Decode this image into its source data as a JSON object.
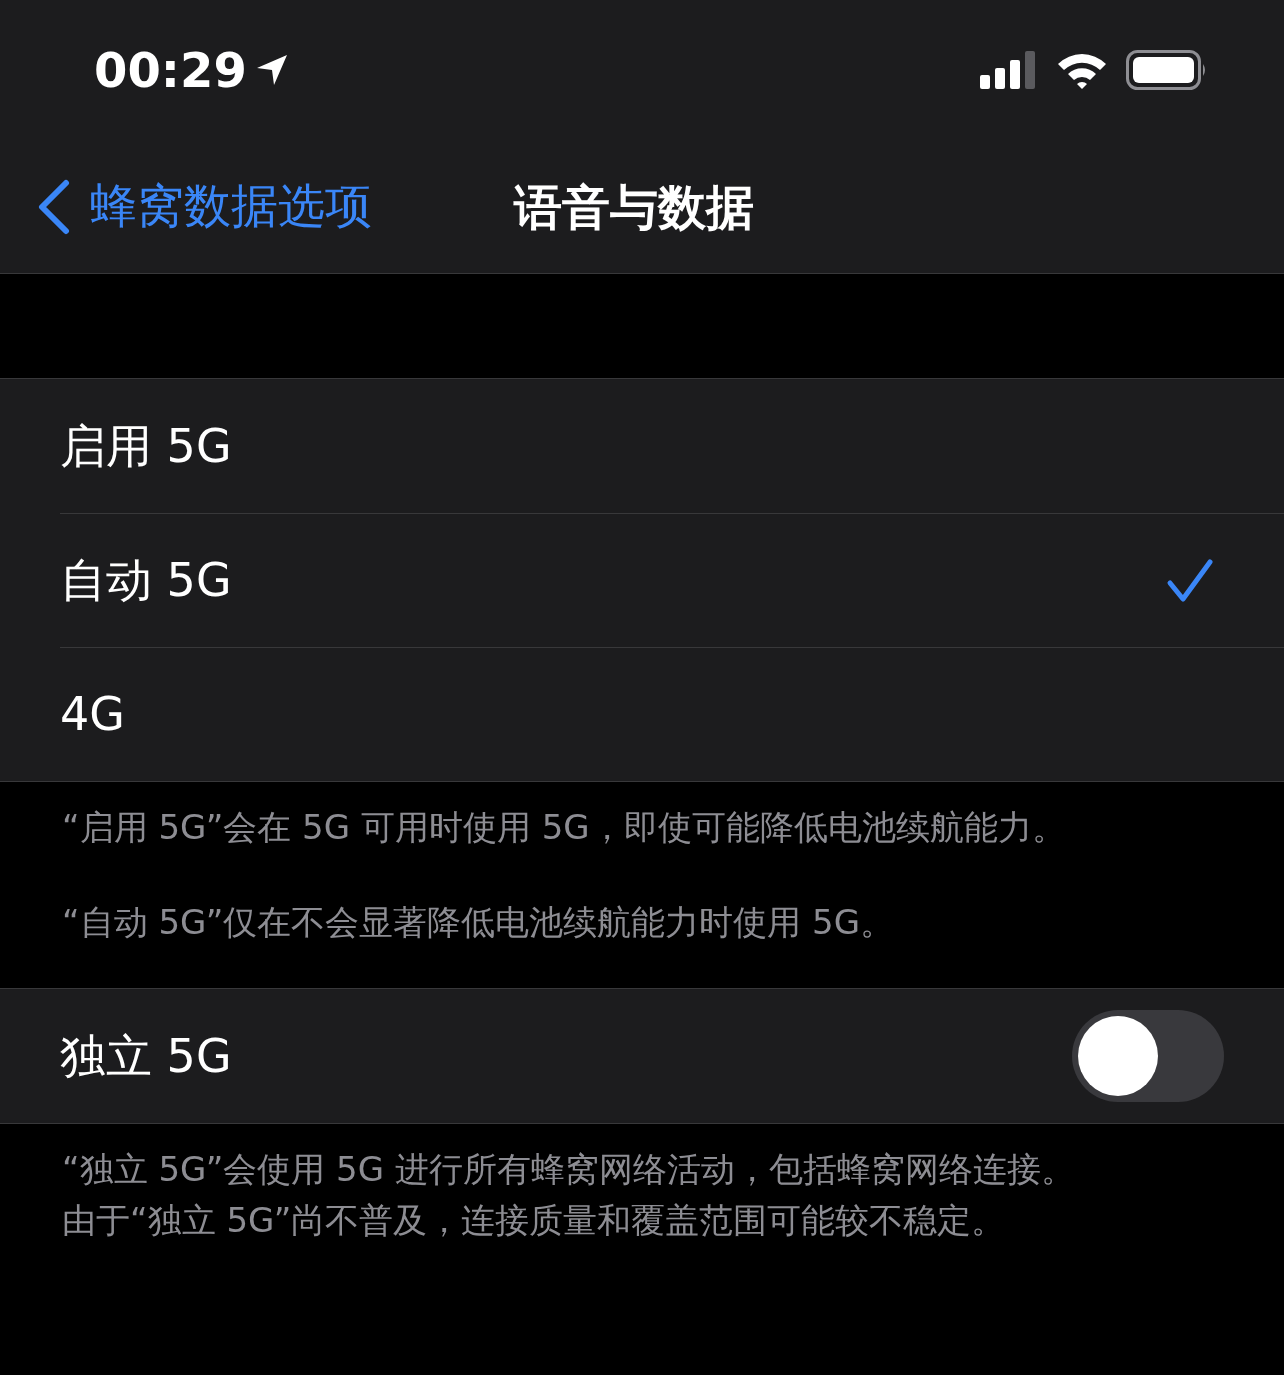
{
  "status_bar": {
    "time": "00:29"
  },
  "nav": {
    "back_label": "蜂窝数据选项",
    "title": "语音与数据"
  },
  "options": [
    {
      "label": "启用 5G",
      "selected": false
    },
    {
      "label": "自动 5G",
      "selected": true
    },
    {
      "label": "4G",
      "selected": false
    }
  ],
  "options_footer": [
    "“启用 5G”会在 5G 可用时使用 5G，即使可能降低电池续航能力。",
    "“自动 5G”仅在不会显著降低电池续航能力时使用 5G。"
  ],
  "toggle": {
    "label": "独立 5G",
    "on": false
  },
  "toggle_footer": [
    "“独立 5G”会使用 5G 进行所有蜂窝网络活动，包括蜂窝网络连接。",
    "由于“独立 5G”尚不普及，连接质量和覆盖范围可能较不稳定。"
  ]
}
